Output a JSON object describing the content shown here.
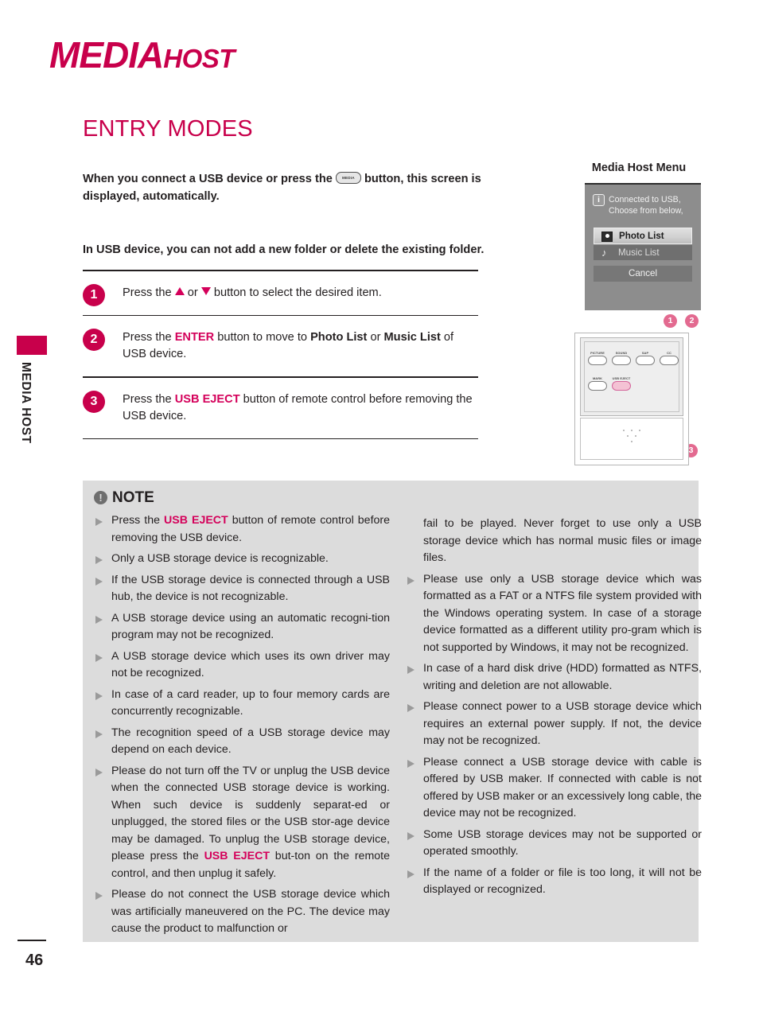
{
  "masthead": {
    "primary": "MEDIA",
    "secondary": "HOST"
  },
  "section_title": "ENTRY MODES",
  "sidebar": {
    "vertical_label": "MEDIA HOST",
    "page_number": "46"
  },
  "intro": {
    "line1_before": "When you connect a USB device or  press the ",
    "button_glyph_label": "MEDIA HOST",
    "line1_after": " button, this screen is displayed, automatically.",
    "line2": "In USB device, you can not add a new folder or delete the existing folder."
  },
  "steps": [
    {
      "number": "1",
      "before": "Press the ",
      "mid": " or ",
      "after": " button to select the desired item.",
      "icon_up": "arrow-up-icon",
      "icon_down": "arrow-down-icon"
    },
    {
      "number": "2",
      "t1": "Press the ",
      "kw1": "ENTER",
      "t2": " button to move to ",
      "b1": "Photo List",
      "t3": " or ",
      "b2": "Music List",
      "t4": " of USB device."
    },
    {
      "number": "3",
      "t1": "Press the ",
      "kw1": "USB EJECT",
      "t2": "  button of remote control before removing the USB device."
    }
  ],
  "menu": {
    "caption": "Media Host Menu",
    "info_icon": "i",
    "info_line1": "Connected to USB,",
    "info_line2": "Choose from below,",
    "items": [
      {
        "label": "Photo List",
        "icon": "photo-icon",
        "selected": true
      },
      {
        "label": "Music List",
        "icon": "music-note-icon",
        "selected": false
      }
    ],
    "cancel_label": "Cancel"
  },
  "remote": {
    "callouts": [
      "1",
      "2",
      "3"
    ],
    "row1": [
      "PICTURE",
      "SOUND",
      "SAP",
      "CC"
    ],
    "row2": [
      "MARK",
      "USB EJECT"
    ],
    "highlighted_button": "USB EJECT"
  },
  "note": {
    "heading": "NOTE",
    "heading_icon": "!",
    "left_items": [
      {
        "bullet": true,
        "pre": "Press the ",
        "kw": "USB EJECT",
        "post": "  button of remote control before removing the USB device."
      },
      {
        "bullet": true,
        "text": "Only a USB storage device is recognizable."
      },
      {
        "bullet": true,
        "text": "If the USB storage device is connected through a USB hub, the device is not recognizable."
      },
      {
        "bullet": true,
        "text": "A USB storage device using an automatic recogni-tion program may not be recognized."
      },
      {
        "bullet": true,
        "text": "A USB storage device which uses its own driver may not be recognized."
      },
      {
        "bullet": true,
        "text": "In case of a card reader, up to four memory cards are concurrently recognizable."
      },
      {
        "bullet": true,
        "text": "The recognition speed of a USB storage device may depend on each device."
      },
      {
        "bullet": true,
        "pre": "Please do not turn off the TV or unplug the USB device when the connected USB storage device is working.  When such device is suddenly separat-ed or unplugged, the stored files or the USB stor-age device may be damaged.  To unplug the USB storage device, please press the ",
        "kw": "USB EJECT",
        "post": " but-ton on the remote control, and then unplug it safely."
      },
      {
        "bullet": true,
        "text": "Please do not connect the USB storage device which was artificially maneuvered on the PC.  The device may cause the product to malfunction or"
      }
    ],
    "right_items": [
      {
        "bullet": false,
        "text": "fail to be played.  Never forget to use only a USB storage device which has normal music files or image files."
      },
      {
        "bullet": true,
        "text": "Please use only a USB storage device which was formatted as a FAT or a NTFS file system provided with the Windows operating system.  In case of a storage device formatted as a different utility pro-gram which is not supported by Windows, it may not be recognized."
      },
      {
        "bullet": true,
        "text": "In case of a hard disk drive (HDD) formatted as NTFS, writing and deletion are not allowable."
      },
      {
        "bullet": true,
        "text": "Please connect power to a USB storage device which requires an external power supply.  If not, the device may not be recognized."
      },
      {
        "bullet": true,
        "text": "Please connect a USB storage device with cable is offered by USB maker.  If connected with cable is not offered by USB maker or an excessively long cable, the device may not be recognized."
      },
      {
        "bullet": true,
        "text": "Some USB storage devices may not be supported or operated smoothly."
      },
      {
        "bullet": true,
        "text": "If the name of a folder or file is too long, it will not be displayed or recognized."
      }
    ]
  }
}
